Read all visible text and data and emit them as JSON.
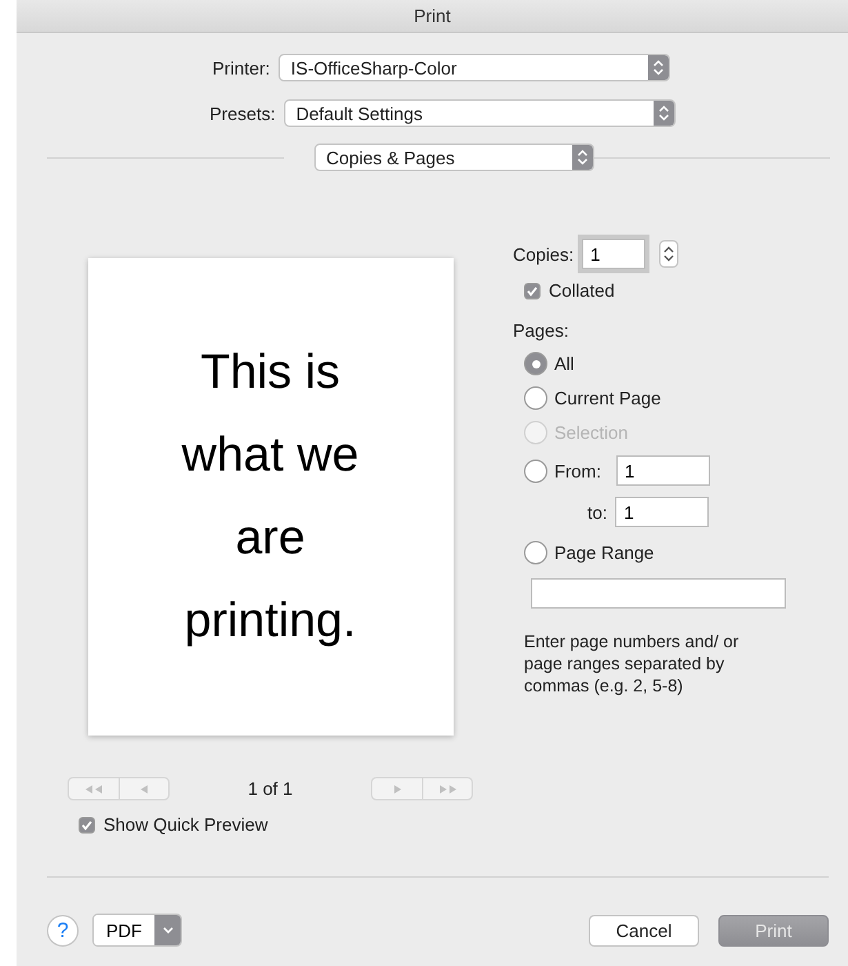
{
  "window": {
    "title": "Print"
  },
  "printer": {
    "label": "Printer:",
    "value": "IS-OfficeSharp-Color"
  },
  "presets": {
    "label": "Presets:",
    "value": "Default Settings"
  },
  "section": {
    "value": "Copies & Pages"
  },
  "preview": {
    "page_text": "This is what we are printing.",
    "page_indicator": "1 of 1",
    "nav_enabled": false
  },
  "copies": {
    "label": "Copies:",
    "value": "1"
  },
  "collated": {
    "label": "Collated",
    "checked": true
  },
  "pages": {
    "label": "Pages:",
    "options": [
      {
        "kind": "plain",
        "label": "All",
        "selected": true,
        "disabled": false
      },
      {
        "kind": "plain",
        "label": "Current Page",
        "selected": false,
        "disabled": false
      },
      {
        "kind": "plain",
        "label": "Selection",
        "selected": false,
        "disabled": true
      },
      {
        "kind": "from_to",
        "label": "From:",
        "from_value": "1",
        "to_label": "to:",
        "to_value": "1",
        "selected": false,
        "disabled": false
      },
      {
        "kind": "range",
        "label": "Page Range",
        "selected": false,
        "disabled": false
      }
    ],
    "help": "Enter page numbers and/ or page ranges separated by commas (e.g. 2, 5-8)"
  },
  "show_quick_preview": {
    "label": "Show Quick Preview",
    "checked": true
  },
  "footer": {
    "help_button": "?",
    "pdf_button": "PDF",
    "buttons": [
      {
        "label": "Cancel",
        "enabled": true
      },
      {
        "label": "Print",
        "enabled": false
      }
    ]
  }
}
